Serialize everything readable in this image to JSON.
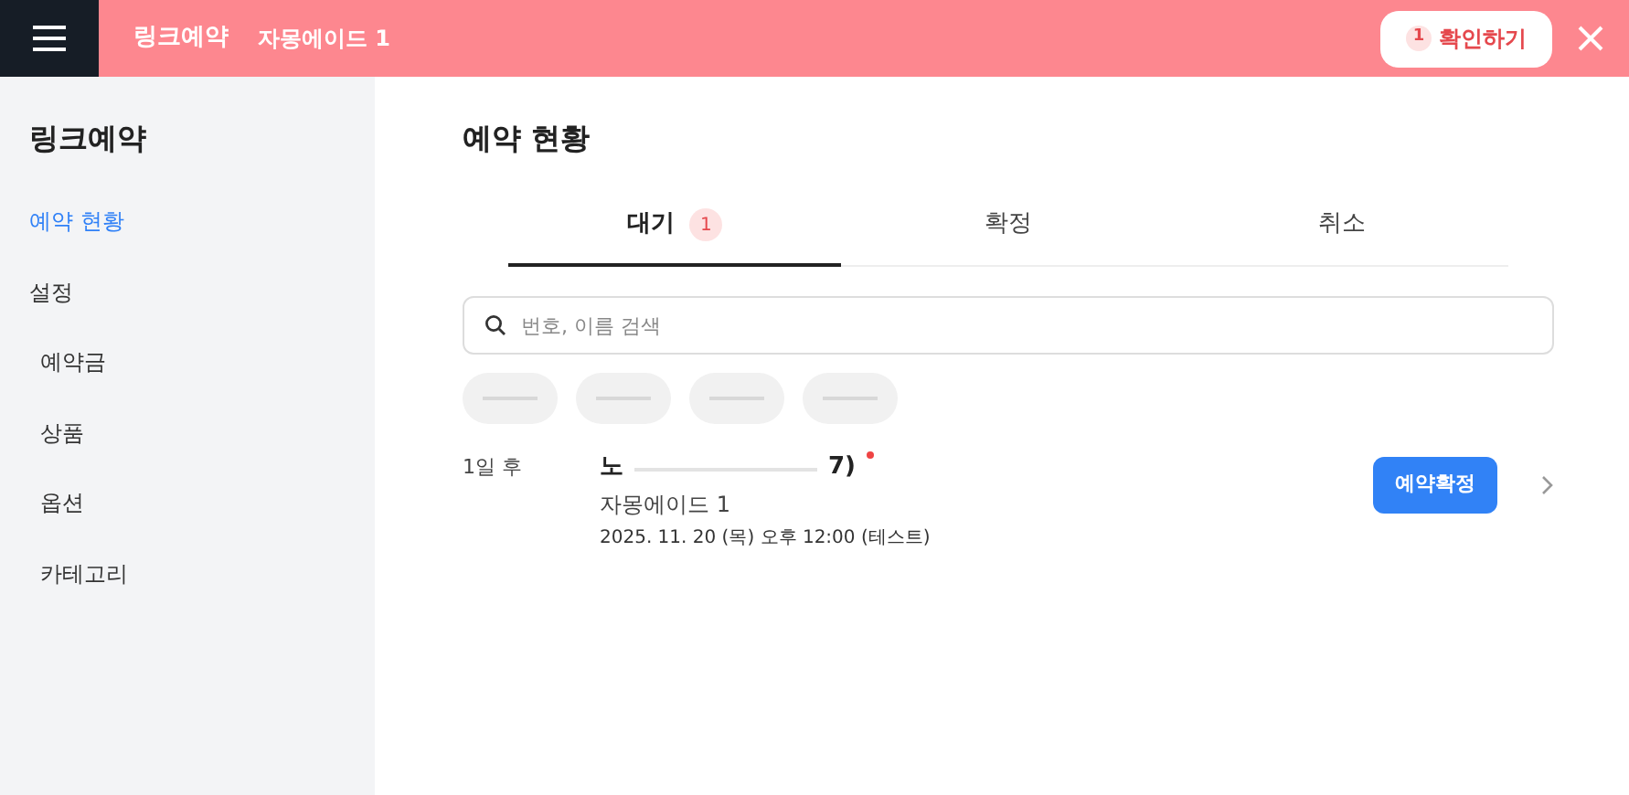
{
  "header": {
    "app_name": "링크예약",
    "shop_name": "자몽에이드 1",
    "confirm_button": {
      "count": "1",
      "label": "확인하기"
    }
  },
  "sidebar": {
    "title": "링크예약",
    "items": [
      {
        "label": "예약 현황",
        "selected": true
      },
      {
        "label": "설정",
        "selected": false,
        "children": [
          {
            "label": "예약금",
            "selected": false
          },
          {
            "label": "상품",
            "selected": false
          },
          {
            "label": "옵션",
            "selected": false
          },
          {
            "label": "카테고리",
            "selected": false
          }
        ]
      }
    ]
  },
  "page_title": "예약 현황",
  "tabs": [
    {
      "label": "대기",
      "count": "1",
      "selected": true
    },
    {
      "label": "확정",
      "selected": false
    },
    {
      "label": "취소",
      "selected": false
    }
  ],
  "search": {
    "placeholder": "번호, 이름 검색"
  },
  "filter_chips": [
    {
      "kind": "redacted"
    },
    {
      "kind": "redacted"
    },
    {
      "kind": "redacted"
    },
    {
      "kind": "redacted"
    }
  ],
  "reservations": [
    {
      "when": "1일 후",
      "name_start": "노",
      "name_end": "7)",
      "new": true,
      "product": "자몽에이드 1",
      "datetime": "2025. 11. 20 (목) 오후 12:00 (테스트)",
      "action": "예약확정"
    }
  ]
}
